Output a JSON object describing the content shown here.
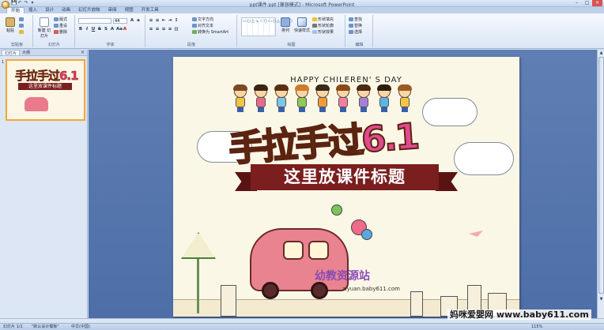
{
  "window": {
    "title": "ppt课件.ppt [兼容模式] - Microsoft PowerPoint",
    "controls": [
      "–",
      "□",
      "×"
    ]
  },
  "quick_access": [
    "💾",
    "↶",
    "↷",
    "▾"
  ],
  "ribbon_tabs": [
    "开始",
    "插入",
    "设计",
    "动画",
    "幻灯片放映",
    "审阅",
    "视图",
    "开发工具"
  ],
  "ribbon": {
    "clipboard": {
      "paste": "粘贴",
      "label": "剪贴板"
    },
    "slides": {
      "new_slide": "新建\n幻灯片",
      "layout": "版式",
      "reset": "重设",
      "delete": "删除",
      "label": "幻灯片"
    },
    "font": {
      "label": "字体",
      "size": "44"
    },
    "paragraph": {
      "label": "段落",
      "text_direction": "文字方向",
      "align_text": "对齐文本",
      "smartart": "转换为 SmartArt"
    },
    "drawing": {
      "label": "绘图",
      "arrange": "排列",
      "quick_styles": "快速样式",
      "fill": "形状填充",
      "outline": "形状轮廓",
      "effects": "形状效果"
    },
    "editing": {
      "label": "编辑",
      "find": "查找",
      "replace": "替换",
      "select": "选择"
    }
  },
  "left_pane": {
    "tabs": [
      "幻灯片",
      "大纲"
    ],
    "close": "×",
    "slide_number": "1"
  },
  "slide": {
    "header": "HAPPY  CHILEREN' S  DAY",
    "title_chars": [
      "手",
      "拉",
      "手",
      "过",
      "6.1"
    ],
    "banner_text": "这里放课件标题",
    "logo_text": "幼教资源站",
    "logo_url": "ziyuan.baby611.com"
  },
  "thumbnail": {
    "title": "手拉手过6.1",
    "banner": "这里放课件标题"
  },
  "status": {
    "slide_info": "幻灯片 1/1",
    "theme": "\"默认设计模板\"",
    "language": "中文(中国)",
    "zoom": "115%"
  },
  "watermark": "妈咪爱婴网 www.baby611.com",
  "colors": {
    "accent": "#f3a63b",
    "banner": "#7b1e1e",
    "workspace": "#5a7bb1"
  }
}
